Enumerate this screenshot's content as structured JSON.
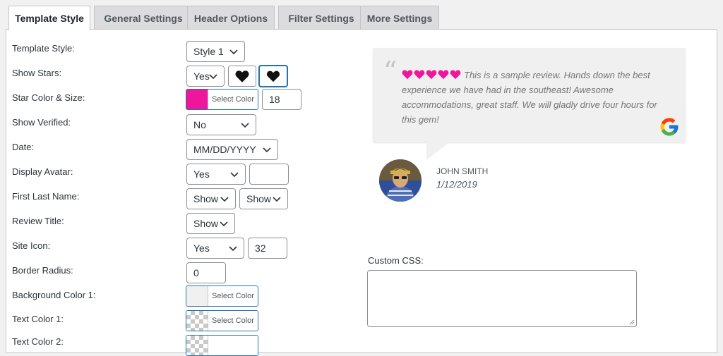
{
  "tabs": [
    {
      "label": "Template Style",
      "active": true
    },
    {
      "label": "General Settings",
      "active": false
    },
    {
      "label": "Header Options",
      "active": false
    },
    {
      "label": "Filter Settings",
      "active": false
    },
    {
      "label": "More Settings",
      "active": false
    }
  ],
  "settings": {
    "template_style": {
      "label": "Template Style:",
      "value": "Style 1"
    },
    "show_stars": {
      "label": "Show Stars:",
      "value": "Yes",
      "icon_a": "heart-outline-icon",
      "icon_b": "heart-filled-icon"
    },
    "star_color": {
      "label": "Star Color & Size:",
      "color": "#f0169b",
      "button": "Select Color",
      "size": "18"
    },
    "show_verified": {
      "label": "Show Verified:",
      "value": "No"
    },
    "date": {
      "label": "Date:",
      "value": "MM/DD/YYYY"
    },
    "display_avatar": {
      "label": "Display Avatar:",
      "value": "Yes",
      "extra": ""
    },
    "first_last_name": {
      "label": "First Last Name:",
      "value1": "Show",
      "value2": "Show"
    },
    "review_title": {
      "label": "Review Title:",
      "value": "Show"
    },
    "site_icon": {
      "label": "Site Icon:",
      "value": "Yes",
      "size": "32"
    },
    "border_radius": {
      "label": "Border Radius:",
      "value": "0"
    },
    "bg_color_1": {
      "label": "Background Color 1:",
      "button": "Select Color",
      "color": "#f0f0f1"
    },
    "text_color_1": {
      "label": "Text Color 1:",
      "button": "Select Color"
    },
    "text_color_2": {
      "label": "Text Color 2:"
    }
  },
  "preview": {
    "quote_mark": "“",
    "hearts_count": 5,
    "heart_color": "#f0169b",
    "review_text": "This is a sample review. Hands down the best experience we have had in the southeast! Awesome accommodations, great staff. We will gladly drive four hours for this gem!",
    "author": "JOHN SMITH",
    "date": "1/12/2019",
    "site_icon": "google-icon"
  },
  "custom_css": {
    "label": "Custom CSS:",
    "value": ""
  }
}
